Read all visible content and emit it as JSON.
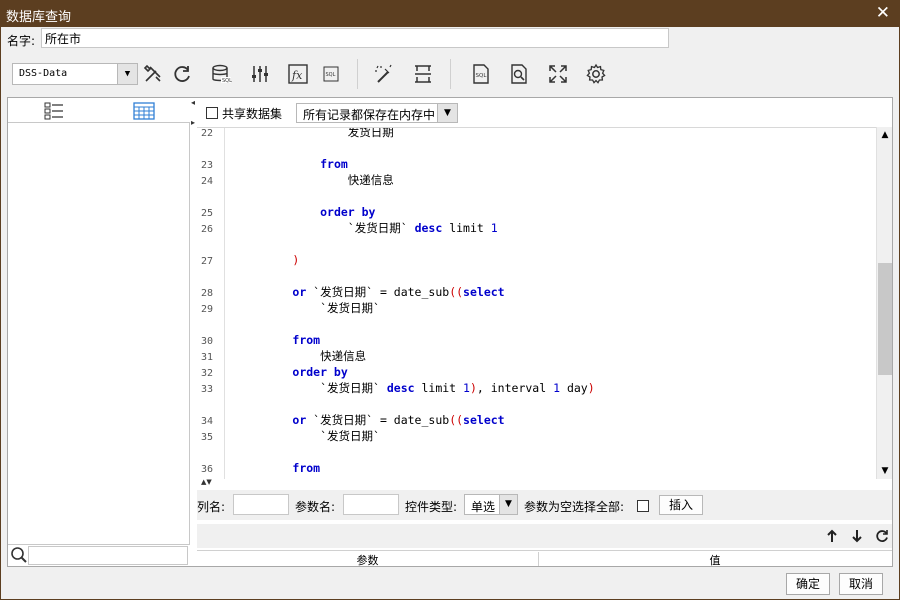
{
  "window": {
    "title": "数据库查询",
    "close_glyph": "✕"
  },
  "name_row": {
    "label": "名字:",
    "value": "所在市"
  },
  "toolbar": {
    "datasource": "DSS-Data",
    "icons": [
      "tools-icon",
      "refresh-icon",
      "database-sql-icon",
      "sliders-icon",
      "function-icon",
      "sql-text-icon",
      "magic-wand-icon",
      "row-height-icon",
      "sql-file-icon",
      "preview-icon",
      "expand-icon",
      "settings-icon"
    ]
  },
  "options": {
    "share_label": "共享数据集",
    "memory_mode": "所有记录都保存在内存中"
  },
  "editor": {
    "lines": [
      {
        "n": "22",
        "segs": [
          {
            "t": "                发货日期",
            "c": ""
          }
        ]
      },
      {
        "n": "23",
        "segs": [
          {
            "t": "            ",
            "c": ""
          },
          {
            "t": "from",
            "c": "kw"
          }
        ]
      },
      {
        "n": "24",
        "segs": [
          {
            "t": "                快递信息",
            "c": ""
          }
        ]
      },
      {
        "n": "25",
        "segs": [
          {
            "t": "            ",
            "c": ""
          },
          {
            "t": "order by",
            "c": "kw"
          }
        ]
      },
      {
        "n": "26",
        "segs": [
          {
            "t": "                `发货日期` ",
            "c": ""
          },
          {
            "t": "desc",
            "c": "kw"
          },
          {
            "t": " limit ",
            "c": ""
          },
          {
            "t": "1",
            "c": "nm"
          }
        ]
      },
      {
        "n": "27",
        "segs": [
          {
            "t": "        ",
            "c": ""
          },
          {
            "t": ")",
            "c": "rp"
          }
        ]
      },
      {
        "n": "28",
        "segs": [
          {
            "t": "        ",
            "c": ""
          },
          {
            "t": "or",
            "c": "kw"
          },
          {
            "t": " `发货日期` = date_sub",
            "c": ""
          },
          {
            "t": "((",
            "c": "rp"
          },
          {
            "t": "select",
            "c": "kw"
          }
        ]
      },
      {
        "n": "29",
        "segs": [
          {
            "t": "            `发货日期`",
            "c": ""
          }
        ]
      },
      {
        "n": "30",
        "segs": [
          {
            "t": "        ",
            "c": ""
          },
          {
            "t": "from",
            "c": "kw"
          }
        ]
      },
      {
        "n": "31",
        "segs": [
          {
            "t": "            快递信息",
            "c": ""
          }
        ]
      },
      {
        "n": "32",
        "segs": [
          {
            "t": "        ",
            "c": ""
          },
          {
            "t": "order by",
            "c": "kw"
          }
        ]
      },
      {
        "n": "33",
        "segs": [
          {
            "t": "            `发货日期` ",
            "c": ""
          },
          {
            "t": "desc",
            "c": "kw"
          },
          {
            "t": " limit ",
            "c": ""
          },
          {
            "t": "1",
            "c": "nm"
          },
          {
            "t": ")",
            "c": "rp"
          },
          {
            "t": ", interval ",
            "c": ""
          },
          {
            "t": "1",
            "c": "nm"
          },
          {
            "t": " day",
            "c": ""
          },
          {
            "t": ")",
            "c": "rp"
          }
        ]
      },
      {
        "n": "34",
        "segs": [
          {
            "t": "        ",
            "c": ""
          },
          {
            "t": "or",
            "c": "kw"
          },
          {
            "t": " `发货日期` = date_sub",
            "c": ""
          },
          {
            "t": "((",
            "c": "rp"
          },
          {
            "t": "select",
            "c": "kw"
          }
        ]
      },
      {
        "n": "35",
        "segs": [
          {
            "t": "            `发货日期`",
            "c": ""
          }
        ]
      },
      {
        "n": "36",
        "segs": [
          {
            "t": "        ",
            "c": ""
          },
          {
            "t": "from",
            "c": "kw"
          }
        ]
      }
    ],
    "colors": {
      "keyword": "#0000cc",
      "paren": "#cc0000",
      "number": "#0000cc"
    }
  },
  "params": {
    "col_label": "列名:",
    "param_label": "参数名:",
    "ctrl_type_label": "控件类型:",
    "ctrl_type_value": "单选",
    "empty_all_label": "参数为空选择全部:",
    "insert_label": "插入"
  },
  "table": {
    "headers": [
      "参数",
      "值"
    ]
  },
  "footer": {
    "ok_label": "确定",
    "cancel_label": "取消"
  },
  "theme": {
    "titlebar": "#5c3e20",
    "background": "#f0f0f0"
  }
}
